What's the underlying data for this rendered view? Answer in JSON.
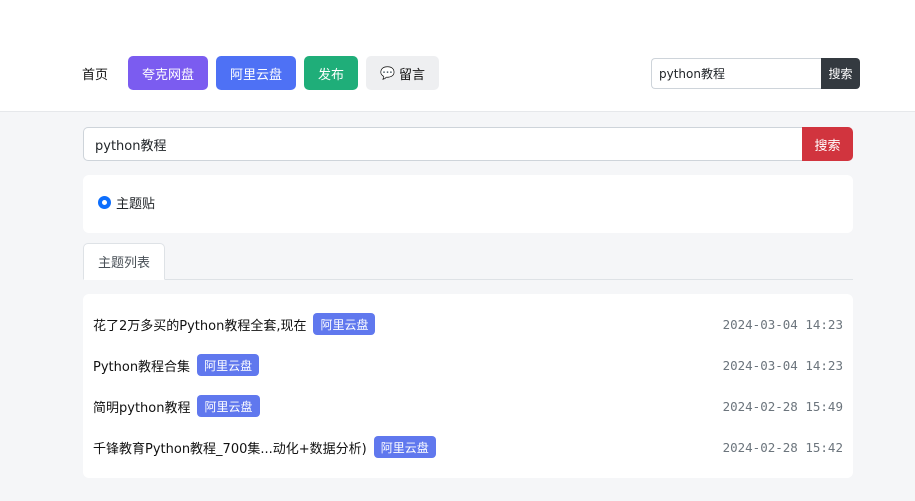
{
  "nav": {
    "home": "首页",
    "quark": "夸克网盘",
    "aliyun": "阿里云盘",
    "publish": "发布",
    "message": "留言",
    "message_icon": "chat-bubble-icon"
  },
  "top_search": {
    "value": "python教程",
    "button": "搜索"
  },
  "main_search": {
    "value": "python教程",
    "button": "搜索"
  },
  "filter": {
    "radio_label": "主题贴",
    "checked": true
  },
  "tabs": [
    {
      "label": "主题列表",
      "active": true
    }
  ],
  "posts": [
    {
      "title": "花了2万多买的Python教程全套,现在",
      "tag": "阿里云盘",
      "date": "2024-03-04 14:23"
    },
    {
      "title": "Python教程合集",
      "tag": "阿里云盘",
      "date": "2024-03-04 14:23"
    },
    {
      "title": "简明python教程",
      "tag": "阿里云盘",
      "date": "2024-02-28 15:49"
    },
    {
      "title": "千锋教育Python教程_700集...动化+数据分析)",
      "tag": "阿里云盘",
      "date": "2024-02-28 15:42"
    }
  ],
  "colors": {
    "quark": "#7b5cf0",
    "aliyun": "#4e71f5",
    "publish": "#1fae79",
    "search_danger": "#d1343e",
    "search_dark": "#343a40",
    "tag": "#6078ee"
  }
}
